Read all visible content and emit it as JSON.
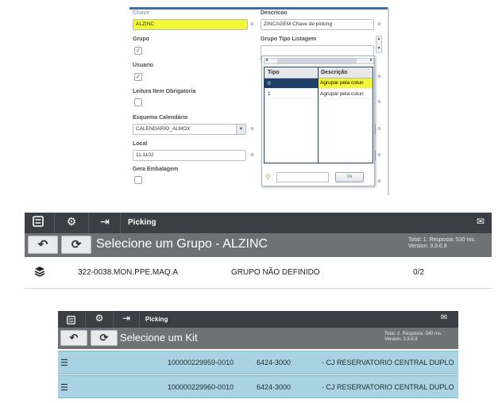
{
  "form": {
    "fields": {
      "chave_label": "Chave",
      "chave_value": "ALZINC",
      "descricao_label": "Descricao",
      "descricao_value": "ZINCAGEM Chave de picking",
      "grupo_label": "Grupo",
      "grupo_tipo_listagem_label": "Grupo Tipo Listagem",
      "usuario_label": "Usuario",
      "leitura_label": "Leitura Item Obrigatoria",
      "esquema_label": "Esquema Calendário",
      "esquema_value": "CALENDARIO_ALMOX",
      "local_label": "Local",
      "local_value": "11.1102",
      "gera_label": "Gera Embalagem"
    },
    "checkboxes": {
      "grupo": true,
      "usuario": true,
      "leitura": false,
      "gera": false
    },
    "popup": {
      "columns": [
        "Tipo",
        "Descrição"
      ],
      "rows": [
        {
          "tipo": "0",
          "descricao": "Agrupar pela colun",
          "selected": true
        },
        {
          "tipo": "1",
          "descricao": "Agrupar pela colun",
          "selected": false
        }
      ],
      "ok_label": "Ok",
      "search_value": ""
    },
    "colors": {
      "highlight": "#f4f736",
      "selected_row": "#1e3f66",
      "accent": "#3d6ea8"
    }
  },
  "panel2": {
    "appbar": {
      "menu_icon": "list-icon",
      "settings_icon": "gear-icon",
      "exit_icon": "sign-in-icon",
      "title": "Picking",
      "mail_icon": "mail-icon"
    },
    "back_icon": "undo-icon",
    "refresh_icon": "refresh-icon",
    "subtitle": "Selecione um Grupo - ALZINC",
    "stats_line1": "Total: 1. Resposta: 530 ms.",
    "stats_line2": "Version: 3.9.6.8",
    "rows": [
      {
        "icon": "layers-icon",
        "code": "322-0038.MON.PPE.MAQ.A",
        "group": "GRUPO NÃO DEFINIDO",
        "count": "0/2"
      }
    ]
  },
  "panel3": {
    "appbar": {
      "title": "Picking"
    },
    "subtitle": "Selecione um Kit",
    "stats_line1": "Total: 2. Resposta: 340 ms.",
    "stats_line2": "Version: 3.9.6.8",
    "rows": [
      {
        "icon": "list-icon",
        "code": "100000229959-0010",
        "ref": "6424-3000",
        "desc": "- CJ RESERVATORIO CENTRAL DUPLO"
      },
      {
        "icon": "list-icon",
        "code": "100000229960-0010",
        "ref": "6424-3000",
        "desc": "- CJ RESERVATORIO CENTRAL DUPLO"
      }
    ],
    "colors": {
      "row_bg": "#a9d3e3"
    }
  }
}
